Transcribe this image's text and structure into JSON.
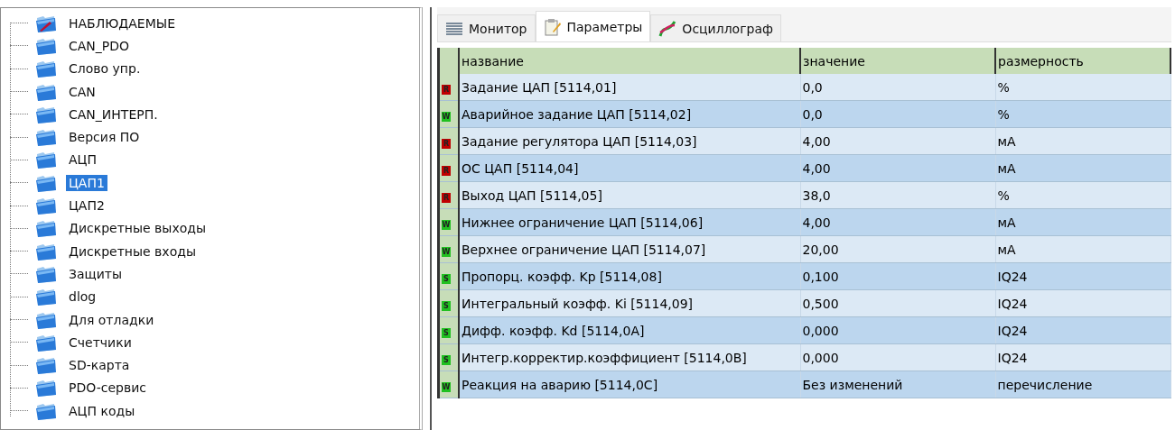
{
  "tree": {
    "items": [
      {
        "label": "НАБЛЮДАЕМЫЕ",
        "kind": "watched",
        "selected": false
      },
      {
        "label": "CAN_PDO",
        "kind": "folder",
        "selected": false
      },
      {
        "label": "Слово упр.",
        "kind": "folder",
        "selected": false
      },
      {
        "label": "CAN",
        "kind": "folder",
        "selected": false
      },
      {
        "label": "CAN_ИНТЕРП.",
        "kind": "folder",
        "selected": false
      },
      {
        "label": "Версия ПО",
        "kind": "folder",
        "selected": false
      },
      {
        "label": "АЦП",
        "kind": "folder",
        "selected": false
      },
      {
        "label": "ЦАП1",
        "kind": "folder",
        "selected": true
      },
      {
        "label": "ЦАП2",
        "kind": "folder",
        "selected": false
      },
      {
        "label": "Дискретные выходы",
        "kind": "folder",
        "selected": false
      },
      {
        "label": "Дискретные входы",
        "kind": "folder",
        "selected": false
      },
      {
        "label": "Защиты",
        "kind": "folder",
        "selected": false
      },
      {
        "label": "dlog",
        "kind": "folder",
        "selected": false
      },
      {
        "label": "Для отладки",
        "kind": "folder",
        "selected": false
      },
      {
        "label": "Счетчики",
        "kind": "folder",
        "selected": false
      },
      {
        "label": "SD-карта",
        "kind": "folder",
        "selected": false
      },
      {
        "label": "PDO-сервис",
        "kind": "folder",
        "selected": false
      },
      {
        "label": "АЦП коды",
        "kind": "folder",
        "selected": false
      }
    ]
  },
  "tabs": [
    {
      "label": "Монитор",
      "kind": "monitor",
      "selected": false
    },
    {
      "label": "Параметры",
      "kind": "params",
      "selected": true
    },
    {
      "label": "Осциллограф",
      "kind": "scope",
      "selected": false
    }
  ],
  "table": {
    "columns": [
      "название",
      "значение",
      "размерность"
    ],
    "rows": [
      {
        "marker": "R",
        "color": "#c00000",
        "name": "Задание ЦАП [5114,01]",
        "value": "0,0",
        "unit": "%"
      },
      {
        "marker": "W",
        "color": "#20c020",
        "name": "Аварийное задание ЦАП [5114,02]",
        "value": "0,0",
        "unit": "%"
      },
      {
        "marker": "R",
        "color": "#c00000",
        "name": "Задание регулятора ЦАП [5114,03]",
        "value": "4,00",
        "unit": "мА"
      },
      {
        "marker": "R",
        "color": "#c00000",
        "name": "ОС ЦАП [5114,04]",
        "value": "4,00",
        "unit": "мА"
      },
      {
        "marker": "R",
        "color": "#c00000",
        "name": "Выход ЦАП [5114,05]",
        "value": "38,0",
        "unit": "%"
      },
      {
        "marker": "W",
        "color": "#20c020",
        "name": "Нижнее ограничение ЦАП [5114,06]",
        "value": "4,00",
        "unit": "мА"
      },
      {
        "marker": "W",
        "color": "#20c020",
        "name": "Верхнее ограничение ЦАП [5114,07]",
        "value": "20,00",
        "unit": "мА"
      },
      {
        "marker": "S",
        "color": "#20c020",
        "name": "Пропорц. коэфф. Kp [5114,08]",
        "value": "0,100",
        "unit": "IQ24"
      },
      {
        "marker": "S",
        "color": "#20c020",
        "name": "Интегральный коэфф. Ki [5114,09]",
        "value": "0,500",
        "unit": "IQ24"
      },
      {
        "marker": "S",
        "color": "#20c020",
        "name": "Дифф. коэфф. Kd [5114,0A]",
        "value": "0,000",
        "unit": "IQ24"
      },
      {
        "marker": "S",
        "color": "#20c020",
        "name": "Интегр.корректир.коэффициент [5114,0B]",
        "value": "0,000",
        "unit": "IQ24"
      },
      {
        "marker": "W",
        "color": "#20c020",
        "name": "Реакция на аварию [5114,0C]",
        "value": "Без изменений",
        "unit": "перечисление"
      }
    ]
  }
}
